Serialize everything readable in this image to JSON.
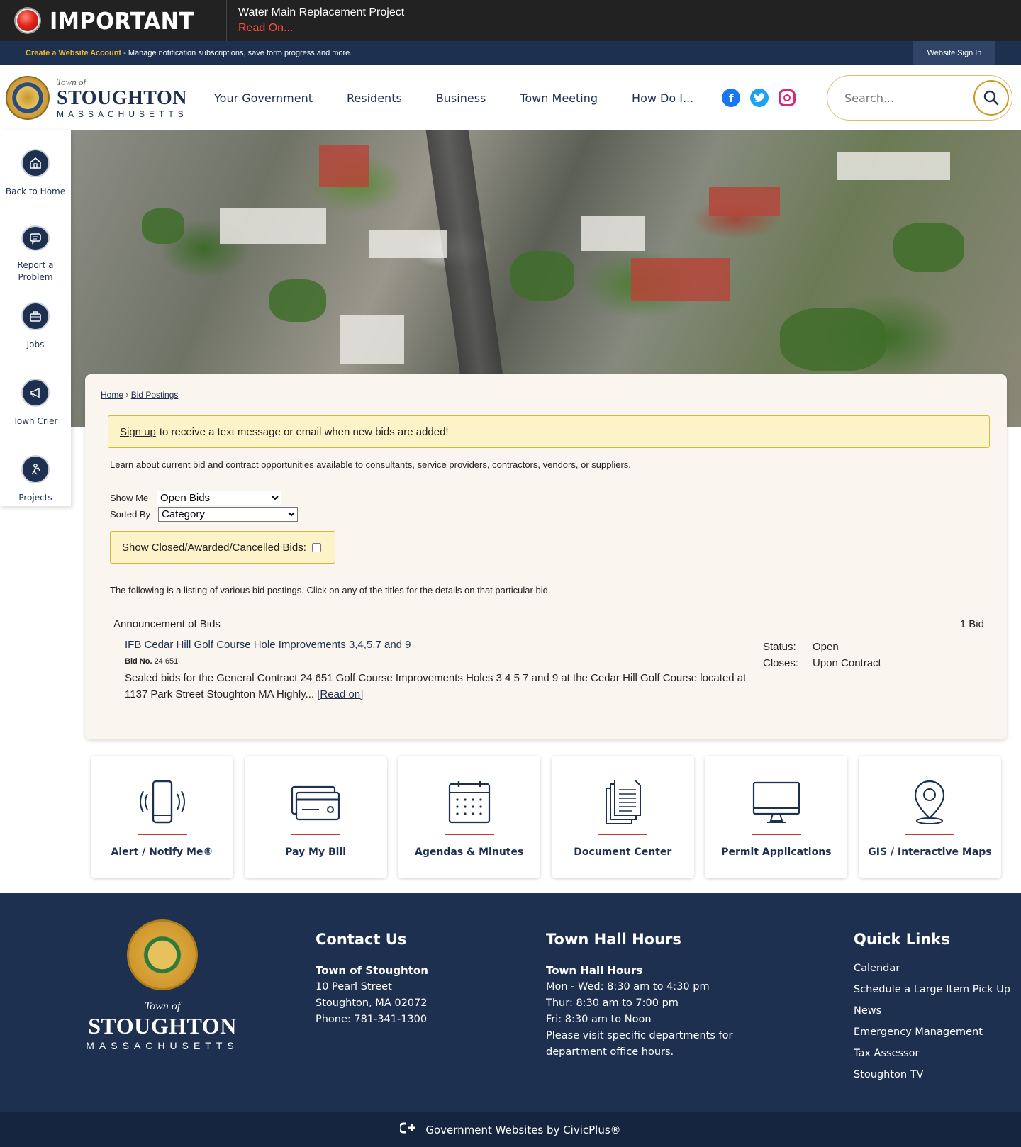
{
  "alert": {
    "label": "IMPORTANT",
    "title": "Water Main Replacement Project",
    "link": "Read On..."
  },
  "account": {
    "create_link": "Create a Website Account",
    "text": " - Manage notification subscriptions, save form progress and more.",
    "signin": "Website Sign In"
  },
  "logo": {
    "town_of": "Town of",
    "name": "STOUGHTON",
    "state": "MASSACHUSETTS"
  },
  "nav": [
    "Your Government",
    "Residents",
    "Business",
    "Town Meeting",
    "How Do I..."
  ],
  "social": [
    "facebook-icon",
    "twitter-icon",
    "instagram-icon"
  ],
  "search": {
    "placeholder": "Search..."
  },
  "quickbar": [
    {
      "label": "Back to Home",
      "icon": "home-icon"
    },
    {
      "label": "Report a Problem",
      "icon": "chat-icon"
    },
    {
      "label": "Jobs",
      "icon": "briefcase-icon"
    },
    {
      "label": "Town Crier",
      "icon": "megaphone-icon"
    },
    {
      "label": "Projects",
      "icon": "worker-icon"
    }
  ],
  "breadcrumb": {
    "home": "Home",
    "sep": "›",
    "current": "Bid Postings"
  },
  "signup": {
    "link": "Sign up",
    "text": "to receive a text message or email when new bids are added!"
  },
  "intro": "Learn about current bid and contract opportunities available to consultants, service providers, contractors, vendors, or suppliers.",
  "filters": {
    "show_label": "Show Me",
    "show_value": "Open Bids",
    "sort_label": "Sorted By",
    "sort_value": "Category"
  },
  "closed_label": "Show Closed/Awarded/Cancelled Bids:",
  "listing_note": "The following is a listing of various bid postings. Click on any of the titles for the details on that particular bid.",
  "category": {
    "name": "Announcement of Bids",
    "count": "1 Bid"
  },
  "bid": {
    "title": "IFB Cedar Hill Golf Course Hole Improvements 3,4,5,7 and 9",
    "no_label": "Bid No.",
    "no": "24 651",
    "desc": "Sealed bids for the General Contract 24 651 Golf Course Improvements Holes 3 4 5 7 and 9 at the Cedar Hill Golf Course located at 1137 Park Street Stoughton MA Highly...",
    "read_on": "[Read on]",
    "status_label": "Status:",
    "status": "Open",
    "closes_label": "Closes:",
    "closes": "Upon Contract"
  },
  "tiles": [
    {
      "label": "Alert / Notify Me®",
      "icon": "phone-icon"
    },
    {
      "label": "Pay My Bill",
      "icon": "credit-card-icon"
    },
    {
      "label": "Agendas & Minutes",
      "icon": "calendar-icon"
    },
    {
      "label": "Document Center",
      "icon": "document-icon"
    },
    {
      "label": "Permit Applications",
      "icon": "monitor-icon"
    },
    {
      "label": "GIS / Interactive Maps",
      "icon": "map-pin-icon"
    }
  ],
  "footer": {
    "town_of": "Town of",
    "name": "STOUGHTON",
    "state": "MASSACHUSETTS",
    "contact": {
      "heading": "Contact Us",
      "org": "Town of Stoughton",
      "addr1": "10 Pearl Street",
      "addr2": "Stoughton, MA 02072",
      "phone": "Phone: 781-341-1300"
    },
    "hours": {
      "heading": "Town Hall Hours",
      "sub": "Town Hall Hours",
      "l1": "Mon - Wed: 8:30 am to 4:30 pm",
      "l2": "Thur: 8:30 am to 7:00 pm",
      "l3": "Fri: 8:30 am to Noon",
      "l4": "Please visit specific departments for",
      "l5": "department office hours."
    },
    "quick": {
      "heading": "Quick Links",
      "links": [
        "Calendar",
        "Schedule a Large Item Pick Up",
        "News",
        "Emergency Management",
        "Tax Assessor",
        "Stoughton TV"
      ]
    }
  },
  "credit": "Government Websites by CivicPlus®",
  "colors": {
    "navy": "#1e3050",
    "alert_red": "#ff4a3a",
    "gold": "#f0b429",
    "tile_accent": "#c0392b"
  }
}
